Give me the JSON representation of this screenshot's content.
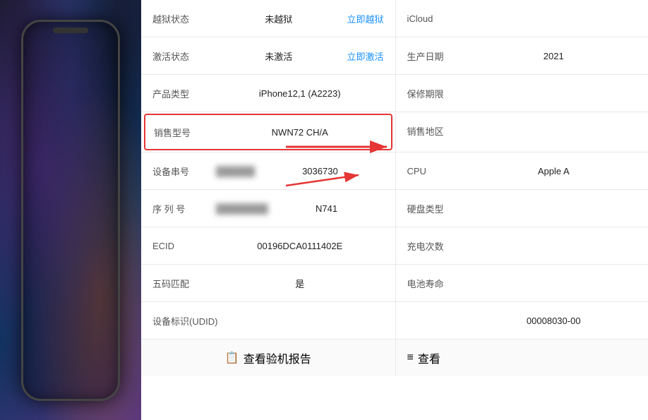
{
  "phone": {
    "label": "iPhone"
  },
  "table": {
    "rows": [
      {
        "label": "越狱状态",
        "value": "未越狱",
        "link": "立即越狱",
        "right_label": "iCloud",
        "right_value": ""
      },
      {
        "label": "激活状态",
        "value": "未激活",
        "link": "立即激活",
        "right_label": "生产日期",
        "right_value": "2021"
      },
      {
        "label": "产品类型",
        "value": "iPhone12,1 (A2223)",
        "link": "",
        "right_label": "保修期限",
        "right_value": ""
      },
      {
        "label": "销售型号",
        "value": "NWN72 CH/A",
        "link": "",
        "right_label": "销售地区",
        "right_value": "",
        "highlight": true
      },
      {
        "label": "设备串号",
        "value_blurred": "██████",
        "value_suffix": "3036730",
        "link": "",
        "right_label": "CPU",
        "right_value": "Apple A",
        "blurred": true
      },
      {
        "label": "序 列 号",
        "value_blurred": "████████",
        "value_suffix": "N741",
        "link": "",
        "right_label": "硬盘类型",
        "right_value": "",
        "blurred": true
      },
      {
        "label": "ECID",
        "value": "00196DCA0111402E",
        "link": "",
        "right_label": "充电次数",
        "right_value": ""
      },
      {
        "label": "五码匹配",
        "value": "是",
        "link": "",
        "right_label": "电池寿命",
        "right_value": ""
      },
      {
        "label": "设备标识(UDID)",
        "value": "",
        "link": "",
        "right_label": "",
        "right_value": "00008030-00"
      }
    ],
    "bottom_btns": [
      {
        "icon": "📋",
        "label": "查看验机报告"
      },
      {
        "icon": "≡",
        "label": "查看"
      }
    ]
  }
}
